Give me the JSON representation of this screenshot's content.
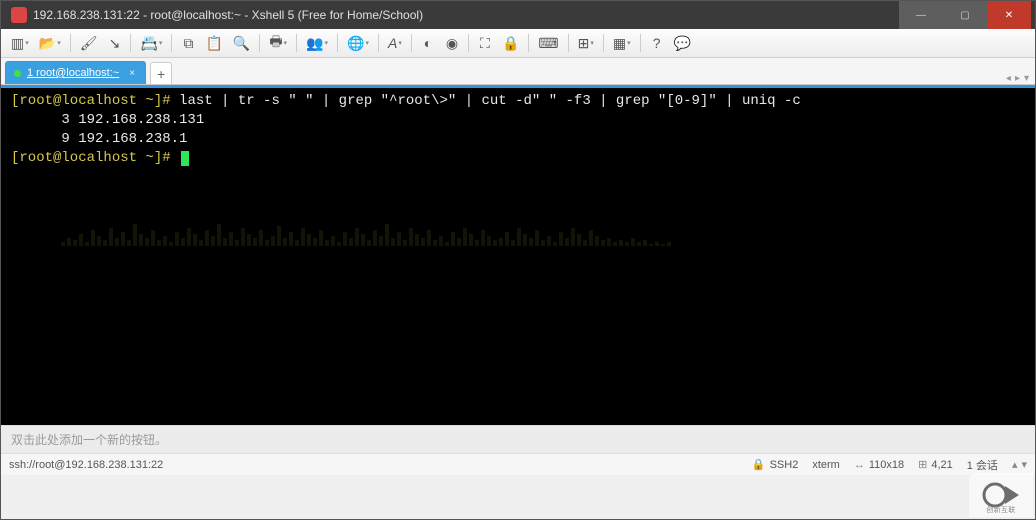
{
  "window": {
    "title": "192.168.238.131:22 - root@localhost:~ - Xshell 5 (Free for Home/School)"
  },
  "tabs": {
    "items": [
      {
        "label": "1 root@localhost:~"
      }
    ],
    "add_label": "+"
  },
  "terminal": {
    "prompt": "[root@localhost ~]#",
    "command": "last | tr -s \" \" | grep \"^root\\>\" | cut -d\" \" -f3 | grep \"[0-9]\" | uniq -c",
    "output_lines": [
      "      3 192.168.238.131",
      "      9 192.168.238.1"
    ]
  },
  "quickbar": {
    "hint": "双击此处添加一个新的按钮。"
  },
  "status": {
    "conn": "ssh://root@192.168.238.131:22",
    "proto": "SSH2",
    "term": "xterm",
    "size": "110x18",
    "cursor": "4,21",
    "sessions_label": "1 会话"
  },
  "watermark": {
    "brand": "创新互联"
  }
}
